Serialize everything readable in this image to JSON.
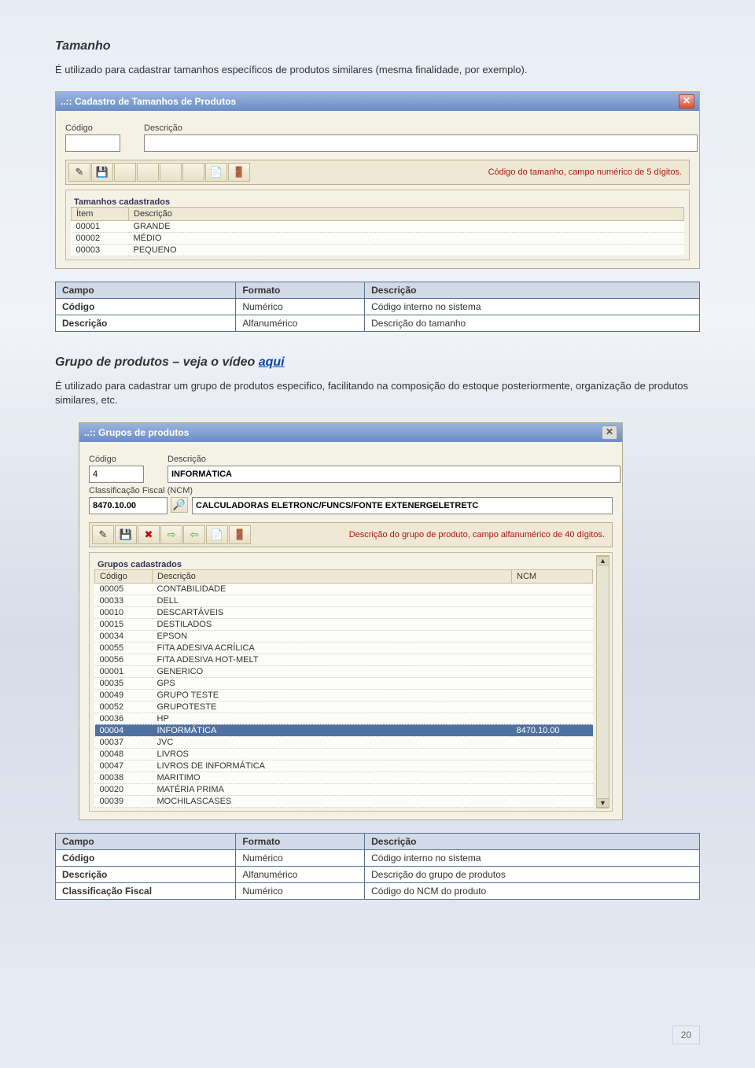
{
  "h1": "Tamanho",
  "p1": "É utilizado para cadastrar tamanhos específicos de produtos similares (mesma finalidade, por exemplo).",
  "w1": {
    "title": "..:: Cadastro de Tamanhos de Produtos",
    "codigo_lbl": "Código",
    "desc_lbl": "Descrição",
    "hint": "Código do tamanho, campo numérico de 5 dígitos.",
    "fs": "Tamanhos cadastrados",
    "cols": {
      "c1": "Ítem",
      "c2": "Descrição"
    },
    "rows": [
      {
        "a": "00001",
        "b": "GRANDE"
      },
      {
        "a": "00002",
        "b": "MÉDIO"
      },
      {
        "a": "00003",
        "b": "PEQUENO"
      }
    ]
  },
  "t1": {
    "h": {
      "a": "Campo",
      "b": "Formato",
      "c": "Descrição"
    },
    "r": [
      {
        "a": "Código",
        "b": "Numérico",
        "c": "Código interno no sistema"
      },
      {
        "a": "Descrição",
        "b": "Alfanumérico",
        "c": "Descrição do tamanho"
      }
    ]
  },
  "h2": "Grupo de produtos – veja o vídeo ",
  "h2link": "aqui",
  "p2": "É utilizado para cadastrar um grupo de produtos especifico, facilitando na composição do estoque posteriormente, organização de produtos similares, etc.",
  "w2": {
    "title": "..:: Grupos de produtos",
    "codigo_lbl": "Código",
    "desc_lbl": "Descrição",
    "ncm_lbl": "Classificação Fiscal (NCM)",
    "codigo_val": "4",
    "desc_val": "INFORMÁTICA",
    "ncm_val": "8470.10.00",
    "ncm_desc": "CALCULADORAS ELETRONC/FUNCS/FONTE EXTENERGELETRETC",
    "hint": "Descrição do grupo de produto, campo alfanumérico de 40 dígitos.",
    "fs": "Grupos cadastrados",
    "cols": {
      "c1": "Código",
      "c2": "Descrição",
      "c3": "NCM"
    },
    "rows": [
      {
        "a": "00005",
        "b": "CONTABILIDADE",
        "c": ""
      },
      {
        "a": "00033",
        "b": "DELL",
        "c": ""
      },
      {
        "a": "00010",
        "b": "DESCARTÁVEIS",
        "c": ""
      },
      {
        "a": "00015",
        "b": "DESTILADOS",
        "c": ""
      },
      {
        "a": "00034",
        "b": "EPSON",
        "c": ""
      },
      {
        "a": "00055",
        "b": "FITA ADESIVA ACRÍLICA",
        "c": ""
      },
      {
        "a": "00056",
        "b": "FITA ADESIVA HOT-MELT",
        "c": ""
      },
      {
        "a": "00001",
        "b": "GENERICO",
        "c": ""
      },
      {
        "a": "00035",
        "b": "GPS",
        "c": ""
      },
      {
        "a": "00049",
        "b": "GRUPO TESTE",
        "c": ""
      },
      {
        "a": "00052",
        "b": "GRUPOTESTE",
        "c": ""
      },
      {
        "a": "00036",
        "b": "HP",
        "c": ""
      },
      {
        "a": "00004",
        "b": "INFORMÁTICA",
        "c": "8470.10.00",
        "sel": true
      },
      {
        "a": "00037",
        "b": "JVC",
        "c": ""
      },
      {
        "a": "00048",
        "b": "LIVROS",
        "c": ""
      },
      {
        "a": "00047",
        "b": "LIVROS DE INFORMÁTICA",
        "c": ""
      },
      {
        "a": "00038",
        "b": "MARITIMO",
        "c": ""
      },
      {
        "a": "00020",
        "b": "MATÉRIA PRIMA",
        "c": ""
      },
      {
        "a": "00039",
        "b": "MOCHILASCASES",
        "c": ""
      }
    ]
  },
  "t2": {
    "h": {
      "a": "Campo",
      "b": "Formato",
      "c": "Descrição"
    },
    "r": [
      {
        "a": "Código",
        "b": "Numérico",
        "c": "Código interno no sistema"
      },
      {
        "a": "Descrição",
        "b": "Alfanumérico",
        "c": "Descrição do grupo de produtos"
      },
      {
        "a": "Classificação Fiscal",
        "b": "Numérico",
        "c": "Código do NCM do produto"
      }
    ]
  },
  "page": "20"
}
